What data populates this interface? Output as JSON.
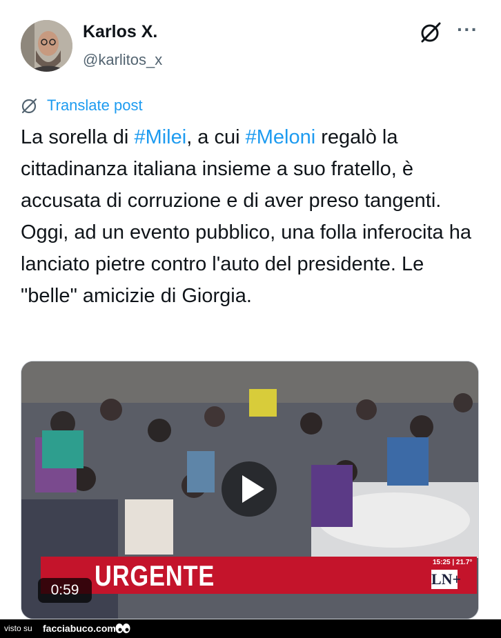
{
  "author": {
    "name": "Karlos X.",
    "handle": "@karlitos_x"
  },
  "icons": {
    "grok": "grok-icon",
    "more": "more-options-icon",
    "translate": "translate-icon",
    "play": "play-icon"
  },
  "translate_label": "Translate post",
  "post": {
    "t1": "La sorella di ",
    "tag1": "#Milei",
    "t2": ", a cui ",
    "tag2": "#Meloni",
    "t3": " regalò la cittadinanza italiana insieme a suo fratello, è accusata di corruzione e di aver preso tangenti. Oggi, ad un evento pubblico, una folla inferocita ha lanciato pietre contro l'auto del presidente. Le \"belle\" amicizie di Giorgia."
  },
  "video": {
    "banner": "URGENTE",
    "time_info": "15:25 | 21.7°",
    "channel_logo": "LN+",
    "duration": "0:59"
  },
  "footer": {
    "prefix": "visto su",
    "brand": "facciabuco.com"
  },
  "colors": {
    "link": "#1d9bf0",
    "text": "#0f1419",
    "secondary": "#536471",
    "banner": "#c4142b"
  }
}
